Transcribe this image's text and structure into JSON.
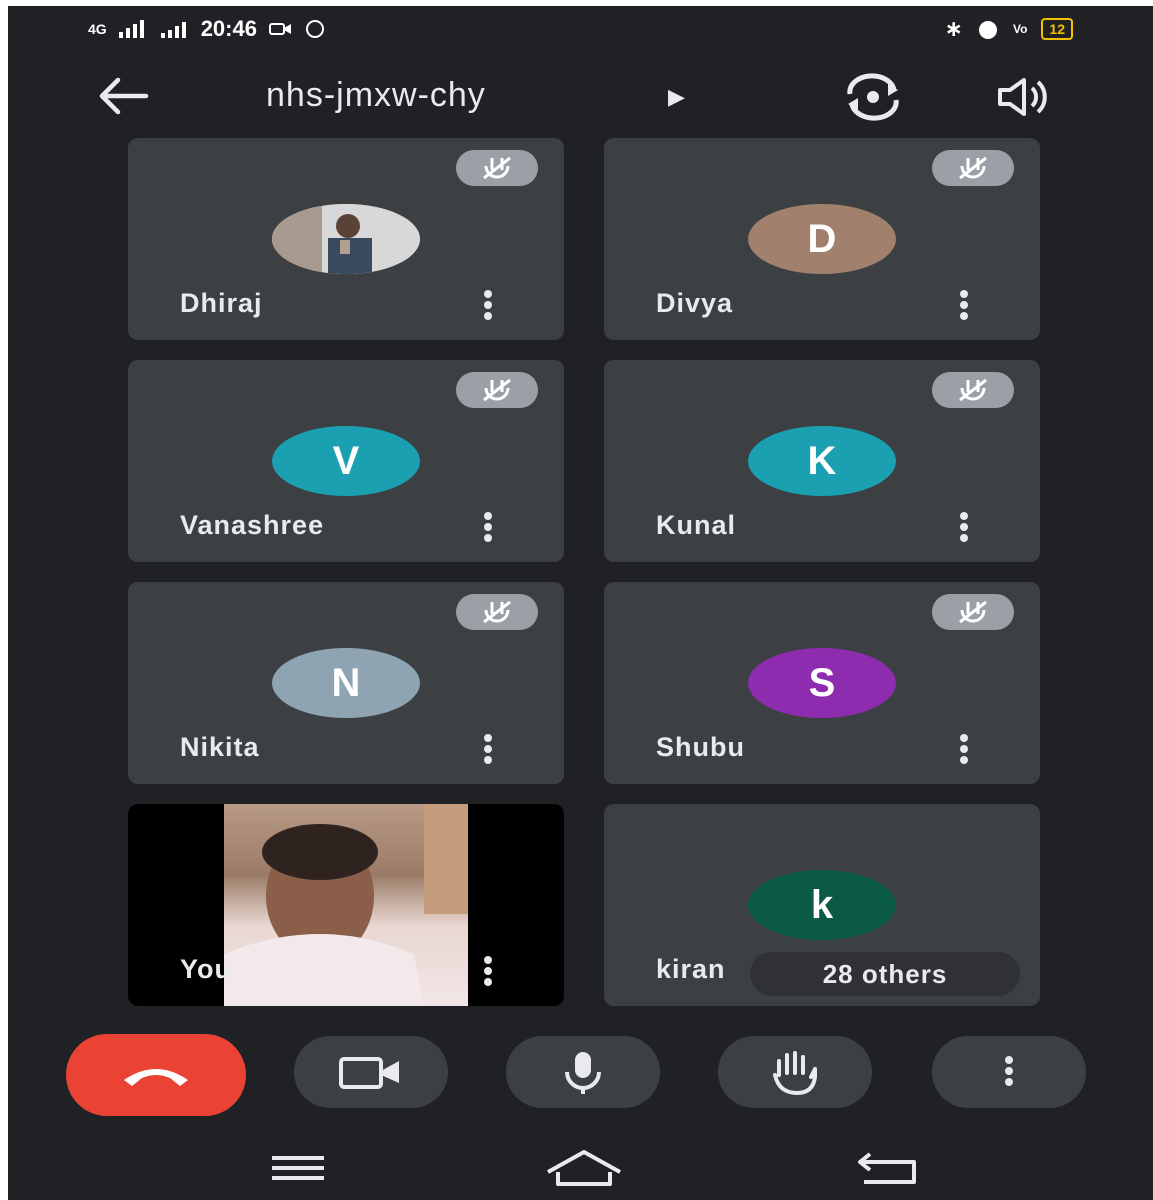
{
  "status_bar": {
    "network": "4G",
    "time": "20:46",
    "battery": "12"
  },
  "header": {
    "meeting_code": "nhs-jmxw-chy",
    "icons": [
      "arrow-left-icon",
      "caret-right-icon",
      "switch-camera-icon",
      "speaker-icon"
    ]
  },
  "participants": [
    {
      "name": "Dhiraj",
      "avatar_type": "photo",
      "muted": true
    },
    {
      "name": "Divya",
      "initial": "D",
      "avatar_color": "#a1806e",
      "muted": true
    },
    {
      "name": "Vanashree",
      "initial": "V",
      "avatar_color": "#1aa0b0",
      "muted": true
    },
    {
      "name": "Kunal",
      "initial": "K",
      "avatar_color": "#1aa0b0",
      "muted": true
    },
    {
      "name": "Nikita",
      "initial": "N",
      "avatar_color": "#8fa4b3",
      "muted": true
    },
    {
      "name": "Shubu",
      "initial": "S",
      "avatar_color": "#8e2cb0",
      "muted": true
    }
  ],
  "self_tile": {
    "name": "You"
  },
  "others_tile": {
    "name": "kiran",
    "initial": "k",
    "avatar_color": "#0b5a45",
    "others_label": "28 others"
  },
  "controls": {
    "icons": [
      "end-call-icon",
      "video-camera-icon",
      "microphone-icon",
      "raise-hand-icon",
      "more-options-icon"
    ],
    "end_call_color": "#ea4335"
  },
  "nav": {
    "icons": [
      "menu-icon",
      "home-icon",
      "back-icon"
    ]
  }
}
